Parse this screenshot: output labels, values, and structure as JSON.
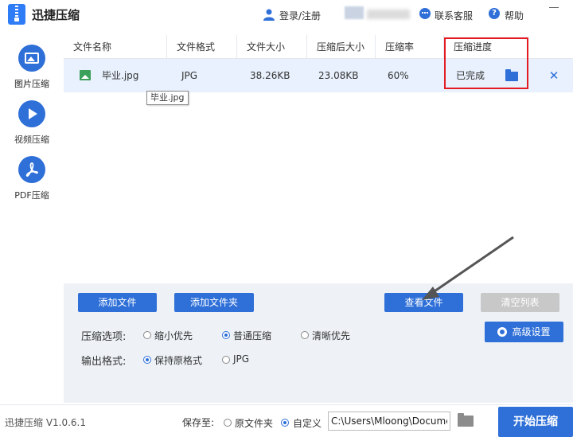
{
  "header": {
    "app_title": "迅捷压缩",
    "login_label": "登录/注册",
    "support_label": "联系客服",
    "help_label": "帮助",
    "help_glyph": "?"
  },
  "sidebar": {
    "items": [
      {
        "label": "图片压缩",
        "icon": "image-icon",
        "active": true
      },
      {
        "label": "视频压缩",
        "icon": "play-icon",
        "active": false
      },
      {
        "label": "PDF压缩",
        "icon": "pdf-icon",
        "active": false
      }
    ]
  },
  "table": {
    "columns": [
      "文件名称",
      "文件格式",
      "文件大小",
      "压缩后大小",
      "压缩率",
      "压缩进度"
    ],
    "rows": [
      {
        "name": "毕业.jpg",
        "format": "JPG",
        "size": "38.26KB",
        "compressed_size": "23.08KB",
        "ratio": "60%",
        "status": "已完成"
      }
    ],
    "tooltip": "毕业.jpg",
    "remove_glyph": "✕"
  },
  "actions": {
    "add_file": "添加文件",
    "add_folder": "添加文件夹",
    "view_file": "查看文件",
    "clear_list": "清空列表",
    "advanced": "高级设置"
  },
  "options": {
    "compress_label": "压缩选项:",
    "compress_options": [
      "缩小优先",
      "普通压缩",
      "清晰优先"
    ],
    "compress_selected": 1,
    "format_label": "输出格式:",
    "format_options": [
      "保持原格式",
      "JPG"
    ],
    "format_selected": 0
  },
  "footer": {
    "version": "迅捷压缩 V1.0.6.1",
    "save_label": "保存至:",
    "save_options": [
      "原文件夹",
      "自定义"
    ],
    "save_selected": 1,
    "path_value": "C:\\Users\\Mloong\\Docume",
    "start_label": "开始压缩"
  },
  "colors": {
    "accent": "#2e6fd8",
    "highlight": "#e31b23",
    "row_selected": "#e8f1fd"
  }
}
